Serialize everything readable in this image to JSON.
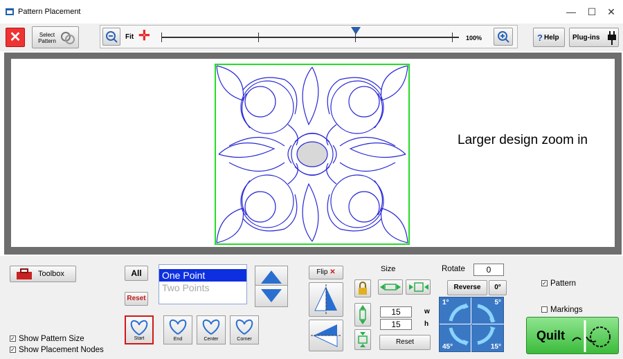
{
  "window": {
    "title": "Pattern Placement",
    "min": "—",
    "max": "☐",
    "close": "✕"
  },
  "toolbar": {
    "select_pattern": "Select Pattern",
    "fit": "Fit",
    "zoom_percent": "100%",
    "help": "Help",
    "plugins": "Plug-ins"
  },
  "canvas": {
    "annotation": "Larger design zoom in"
  },
  "bottom": {
    "toolbox": "Toolbox",
    "all": "All",
    "reset": "Reset",
    "placement_options": [
      "One Point",
      "Two Points"
    ],
    "show_pattern_size": "Show Pattern Size",
    "show_placement_nodes": "Show Placement Nodes",
    "nodes": [
      "Start",
      "End",
      "Center",
      "Corner"
    ],
    "flip": "Flip",
    "size_label": "Size",
    "width_value": "15",
    "height_value": "15",
    "w": "w",
    "h": "h",
    "size_reset": "Reset",
    "rotate_label": "Rotate",
    "rotate_value": "0",
    "reverse": "Reverse",
    "zero_deg": "0°",
    "rot_1": "1°",
    "rot_5": "5°",
    "rot_45": "45°",
    "rot_15": "15°",
    "pattern_check": "Pattern",
    "markings_check": "Markings",
    "quilt": "Quilt"
  },
  "colors": {
    "pattern_line": "#2727d6",
    "boundary": "#22dd22",
    "selection": "#0d2fe0",
    "close_red": "#e33333"
  }
}
